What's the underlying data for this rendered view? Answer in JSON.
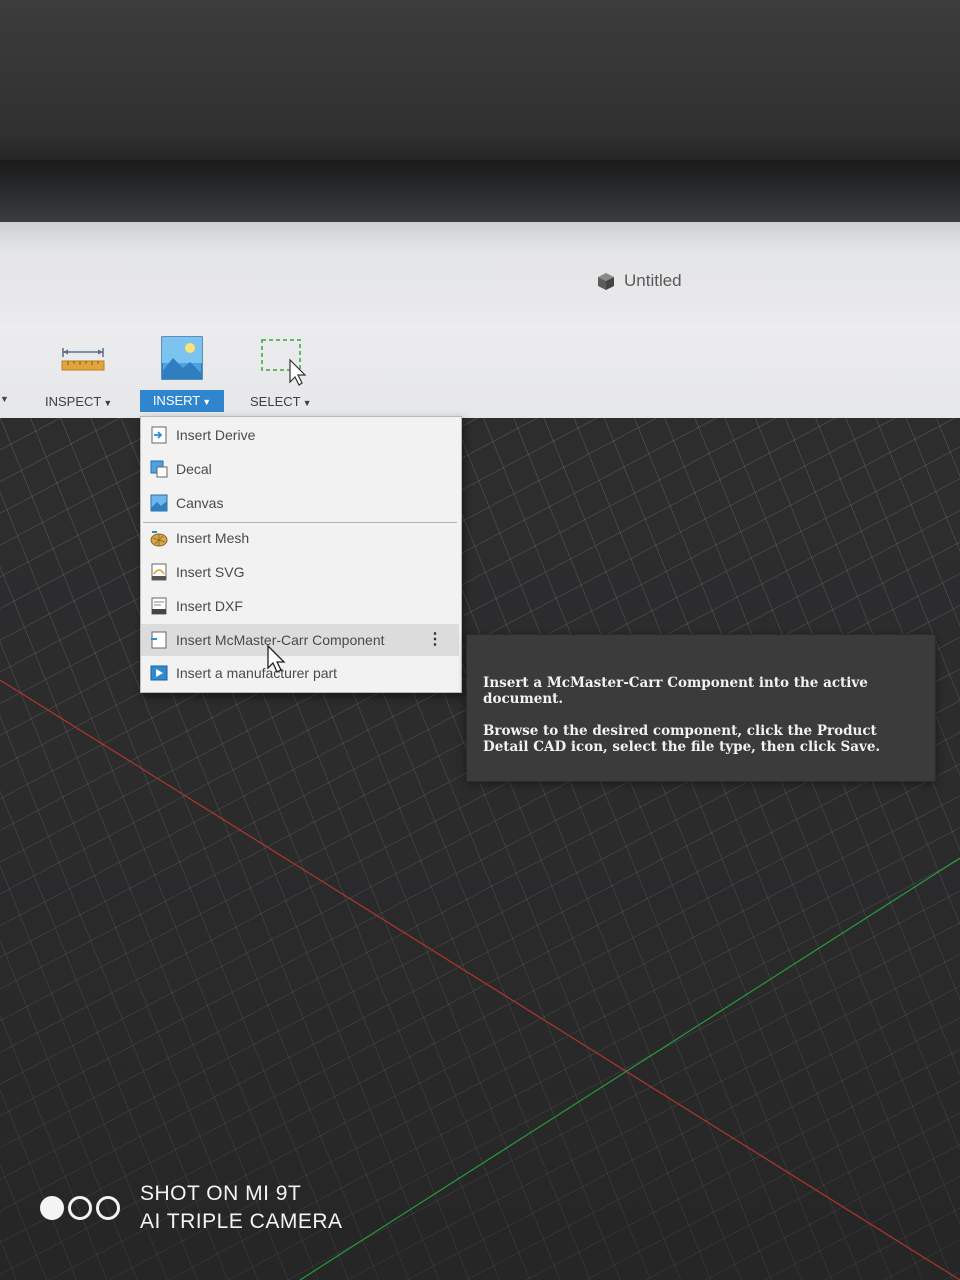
{
  "window": {
    "document_title": "Untitled"
  },
  "toolbar": {
    "inspect_label": "INSPECT",
    "insert_label": "INSERT",
    "select_label": "SELECT",
    "accent_color": "#2f86cf"
  },
  "insert_menu": {
    "items": [
      {
        "label": "Insert Derive",
        "icon": "insert-derive-icon"
      },
      {
        "label": "Decal",
        "icon": "decal-icon"
      },
      {
        "label": "Canvas",
        "icon": "canvas-icon"
      },
      {
        "label": "Insert Mesh",
        "icon": "insert-mesh-icon"
      },
      {
        "label": "Insert SVG",
        "icon": "insert-svg-icon"
      },
      {
        "label": "Insert DXF",
        "icon": "insert-dxf-icon"
      },
      {
        "label": "Insert McMaster-Carr Component",
        "icon": "mcmaster-icon"
      },
      {
        "label": "Insert a manufacturer part",
        "icon": "manufacturer-part-icon"
      }
    ]
  },
  "tooltip": {
    "line1": "Insert a McMaster-Carr Component into the active document.",
    "line2": "Browse to the desired component, click the Product Detail CAD icon, select the file type, then click Save."
  },
  "watermark": {
    "line1": "SHOT ON MI 9T",
    "line2": "AI TRIPLE CAMERA"
  }
}
